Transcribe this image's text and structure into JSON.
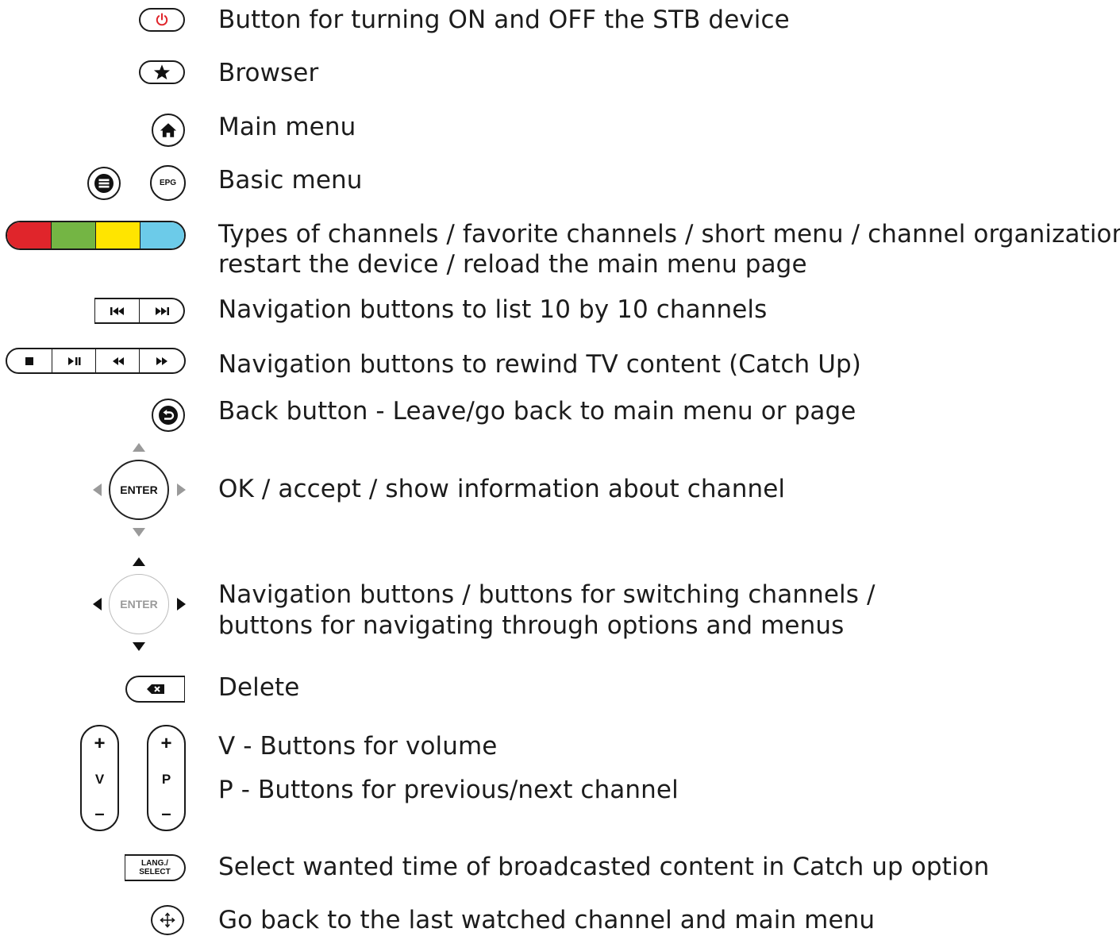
{
  "items": [
    {
      "icon": "power-icon",
      "text": "Button for turning ON and OFF the STB device"
    },
    {
      "icon": "star-icon",
      "text": "Browser"
    },
    {
      "icon": "home-icon",
      "text": "Main menu"
    },
    {
      "icon": "menu-icon",
      "text": "Basic menu"
    },
    {
      "icon": "color-buttons-icon",
      "text": "Types of channels / favorite channels / short menu / channel organization /",
      "text2": "restart the device / reload the main menu page"
    },
    {
      "icon": "skip-buttons-icon",
      "text": "Navigation buttons to list 10 by 10 channels"
    },
    {
      "icon": "playback-buttons-icon",
      "text": "Navigation buttons to rewind TV content (Catch Up)"
    },
    {
      "icon": "back-icon",
      "text": "Back button - Leave/go back to main menu or page"
    },
    {
      "icon": "enter-ok-icon",
      "text": "OK / accept / show information about channel"
    },
    {
      "icon": "enter-navigation-icon",
      "text": "Navigation buttons / buttons for switching channels /",
      "text2": "buttons for navigating through options and menus"
    },
    {
      "icon": "delete-icon",
      "text": "Delete"
    },
    {
      "icon": "volume-rocker-icon",
      "text": "V - Buttons for volume"
    },
    {
      "icon": "channel-rocker-icon",
      "text": "P - Buttons for previous/next channel"
    },
    {
      "icon": "lang-select-icon",
      "text": "Select wanted time of broadcasted content in Catch up option"
    },
    {
      "icon": "last-channel-icon",
      "text": "Go back to the last watched channel and main menu"
    }
  ],
  "labels": {
    "epg": "EPG",
    "enter": "ENTER",
    "lang": "LANG./",
    "select": "SELECT",
    "plus": "+",
    "minus": "–",
    "v": "V",
    "p": "P"
  },
  "colors": {
    "red": "#e0252b",
    "green": "#74b544",
    "yellow": "#ffe500",
    "blue": "#6ccbe9",
    "power": "#e0252b"
  }
}
